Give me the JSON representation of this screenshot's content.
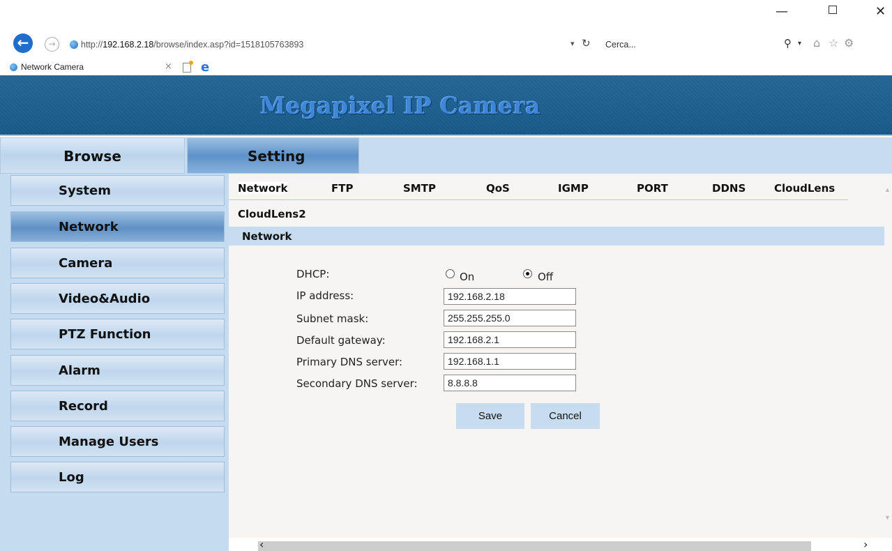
{
  "browser": {
    "url_prefix": "http://",
    "url_host": "192.168.2.18",
    "url_path": "/browse/index.asp?id=1518105763893",
    "search_placeholder": "Cerca...",
    "tab_title": "Network Camera",
    "icons": [
      "back-arrow-icon",
      "forward-arrow-icon",
      "refresh-icon",
      "search-icon",
      "home-icon",
      "star-icon",
      "gear-icon",
      "smiley-icon"
    ]
  },
  "app": {
    "title": "Megapixel IP Camera",
    "topnav": {
      "browse": "Browse",
      "setting": "Setting"
    },
    "sidebar": {
      "items": [
        {
          "label": "System",
          "active": false
        },
        {
          "label": "Network",
          "active": true
        },
        {
          "label": "Camera",
          "active": false
        },
        {
          "label": "Video&Audio",
          "active": false
        },
        {
          "label": "PTZ Function",
          "active": false
        },
        {
          "label": "Alarm",
          "active": false
        },
        {
          "label": "Record",
          "active": false
        },
        {
          "label": "Manage Users",
          "active": false
        },
        {
          "label": "Log",
          "active": false
        }
      ]
    },
    "subtabs": [
      "Network",
      "FTP",
      "SMTP",
      "QoS",
      "IGMP",
      "PORT",
      "DDNS",
      "CloudLens",
      "CloudLens2"
    ],
    "active_subtab": "Network",
    "section_title": "Network",
    "form": {
      "dhcp_label": "DHCP:",
      "dhcp_on_label": "On",
      "dhcp_off_label": "Off",
      "dhcp_value": "Off",
      "ip_label": "IP address:",
      "ip_value": "192.168.2.18",
      "subnet_label": "Subnet mask:",
      "subnet_value": "255.255.255.0",
      "gateway_label": "Default gateway:",
      "gateway_value": "192.168.2.1",
      "dns1_label": "Primary DNS server:",
      "dns1_value": "192.168.1.1",
      "dns2_label": "Secondary DNS server:",
      "dns2_value": "8.8.8.8"
    },
    "buttons": {
      "save": "Save",
      "cancel": "Cancel"
    }
  },
  "colors": {
    "banner": "#1b5f90",
    "nav_bg": "#c7dcef",
    "active_nav": "#5f90c4",
    "content_bg": "#f7f4f4"
  }
}
